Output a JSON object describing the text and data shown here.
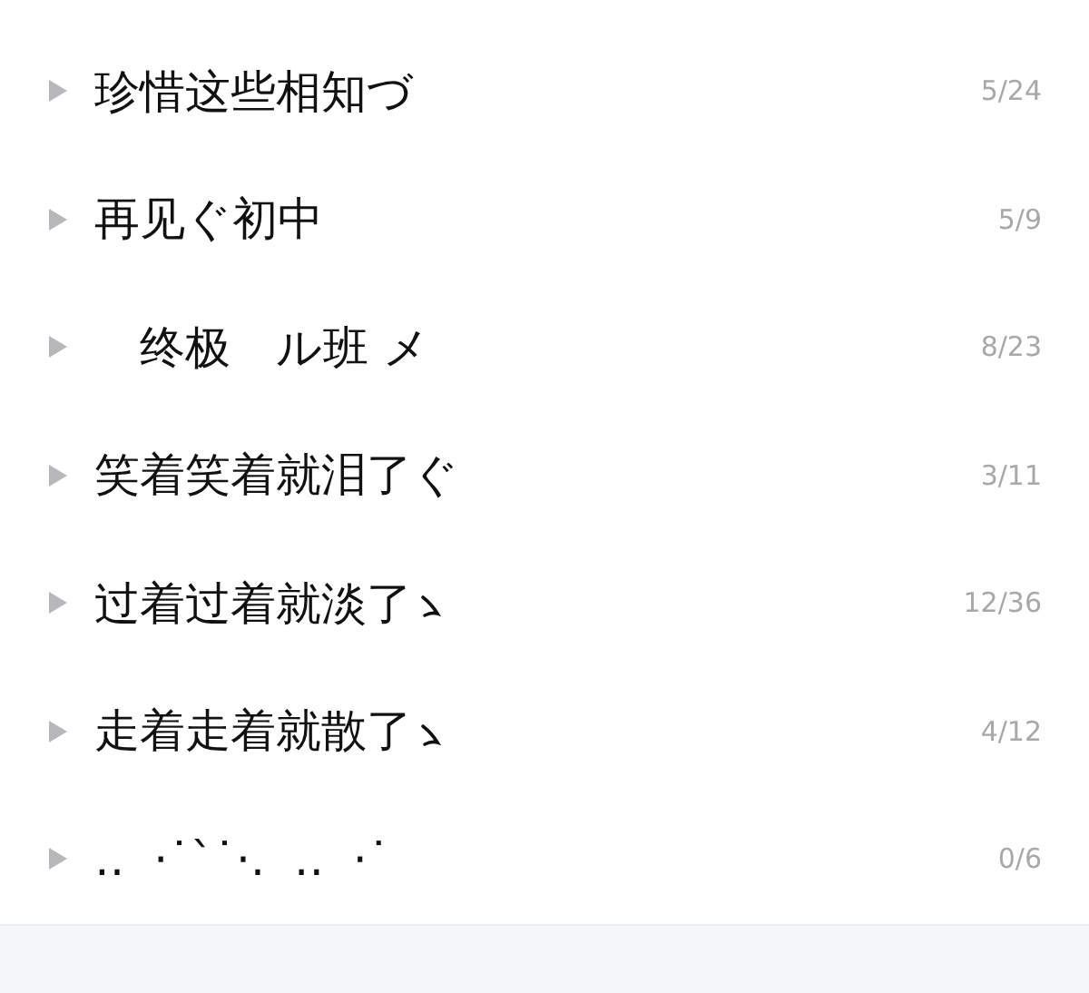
{
  "groups": [
    {
      "name": "珍惜这些相知づ",
      "count": "5/24",
      "expanded": false
    },
    {
      "name": "再见ぐ初中",
      "count": "5/9",
      "expanded": false
    },
    {
      "name": "　终极　ル班 メ",
      "count": "8/23",
      "expanded": false
    },
    {
      "name": "笑着笑着就泪了ぐ",
      "count": "3/11",
      "expanded": false
    },
    {
      "name": "过着过着就淡了",
      "suffix_mark": true,
      "count": "12/36",
      "expanded": false
    },
    {
      "name": "走着走着就散了",
      "suffix_mark": true,
      "count": "4/12",
      "expanded": false
    },
    {
      "name": "‥  ·˙ˋ˙·.  ‥  ·˙",
      "count": "0/6",
      "expanded": false
    }
  ]
}
